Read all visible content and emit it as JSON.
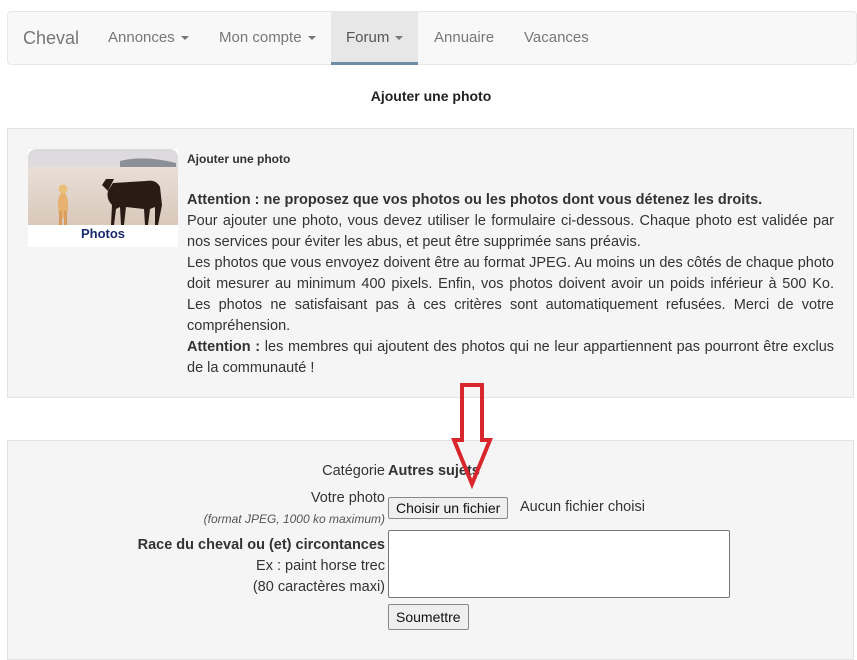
{
  "navbar": {
    "brand": "Cheval",
    "items": [
      {
        "label": "Annonces",
        "caret": true,
        "active": false
      },
      {
        "label": "Mon compte",
        "caret": true,
        "active": false
      },
      {
        "label": "Forum",
        "caret": true,
        "active": true
      },
      {
        "label": "Annuaire",
        "caret": false,
        "active": false
      },
      {
        "label": "Vacances",
        "caret": false,
        "active": false
      }
    ]
  },
  "page": {
    "title": "Ajouter une photo"
  },
  "info": {
    "thumbnail_label": "Photos",
    "heading": "Ajouter une photo",
    "warning1": "Attention : ne proposez que vos photos ou les photos dont vous détenez les droits.",
    "paragraph1": "Pour ajouter une photo, vous devez utiliser le formulaire ci-dessous. Chaque photo est validée par nos services pour éviter les abus, et peut être supprimée sans préavis.",
    "paragraph2": "Les photos que vous envoyez doivent être au format JPEG. Au moins un des côtés de chaque photo doit mesurer au minimum 400 pixels. Enfin, vos photos doivent avoir un poids inférieur à 500 Ko. Les photos ne satisfaisant pas à ces critères sont automatiquement refusées. Merci de votre compréhension.",
    "warning2_label": "Attention :",
    "warning2_text": "les membres qui ajoutent des photos qui ne leur appartiennent pas pourront être exclus de la communauté !"
  },
  "form": {
    "category_label": "Catégorie",
    "category_value": "Autres sujets",
    "photo_label": "Votre photo",
    "photo_hint": "(format JPEG, 1000 ko maximum)",
    "file_button": "Choisir un fichier",
    "file_status": "Aucun fichier choisi",
    "race_label": "Race du cheval ou (et) circontances",
    "race_example": "Ex : paint horse trec",
    "race_limit": "(80 caractères maxi)",
    "race_value": "",
    "submit": "Soumettre"
  },
  "colors": {
    "arrow": "#d9262c",
    "active_underline": "#6d8aa6"
  }
}
